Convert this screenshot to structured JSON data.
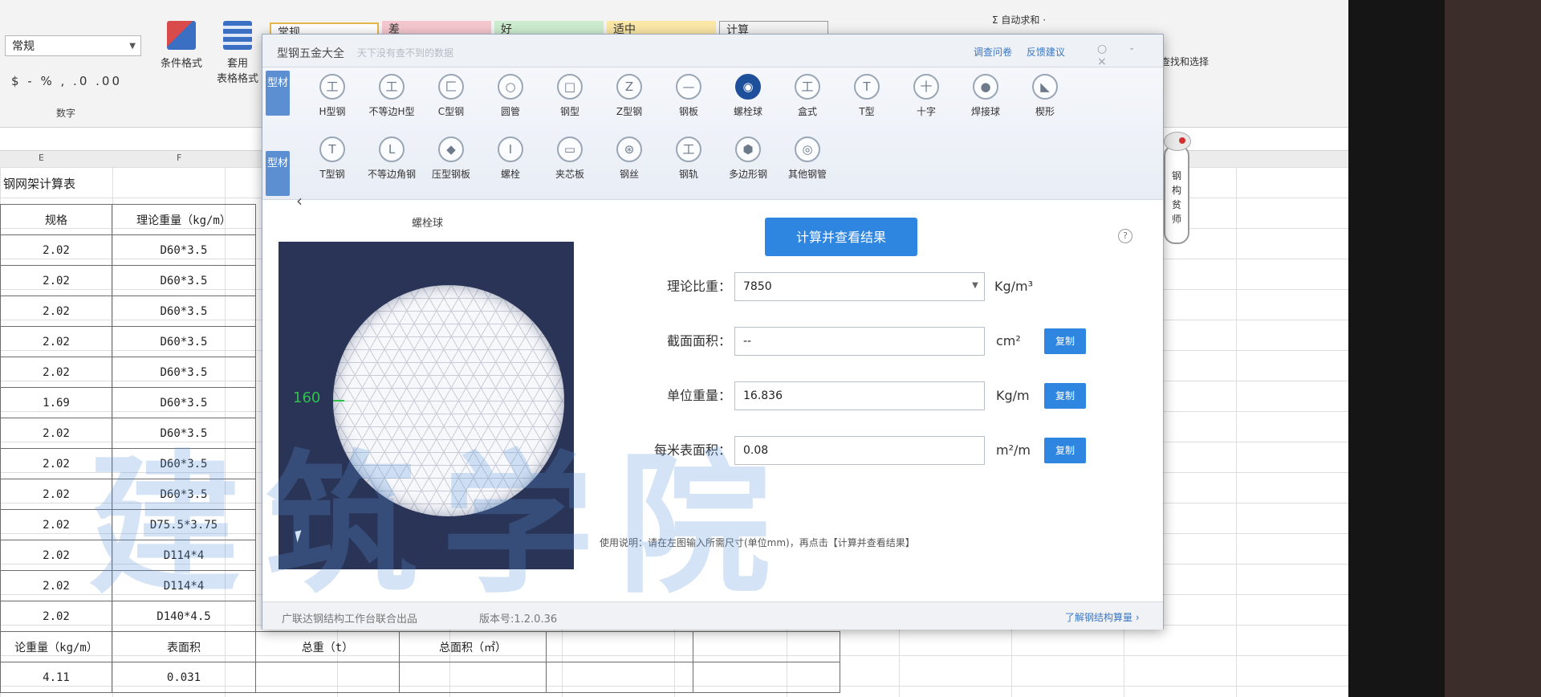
{
  "ribbon": {
    "format_select": "常规",
    "number_format_icons": "$ - % , .0 .00",
    "number_group_label": "数字",
    "cond_format_label": "条件格式",
    "table_format_label_1": "套用",
    "table_format_label_2": "表格格式",
    "styles": [
      {
        "label": "常规",
        "bg": "#ffffff"
      },
      {
        "label": "差",
        "bg": "#f4c7ce"
      },
      {
        "label": "好",
        "bg": "#cdeccf"
      },
      {
        "label": "适中",
        "bg": "#fbe7a6"
      },
      {
        "label": "计算",
        "bg": "#f2f2f2"
      }
    ],
    "autosum_label": "Σ 自动求和 ·",
    "find_select_label": "查找和选择"
  },
  "sheet": {
    "col_letters": [
      "E",
      "F"
    ],
    "title": "钢网架计算表",
    "headers": [
      "规格",
      "理论重量（kg/m）"
    ],
    "rows": [
      [
        "2.02",
        "D60*3.5"
      ],
      [
        "2.02",
        "D60*3.5"
      ],
      [
        "2.02",
        "D60*3.5"
      ],
      [
        "2.02",
        "D60*3.5"
      ],
      [
        "2.02",
        "D60*3.5"
      ],
      [
        "1.69",
        "D60*3.5"
      ],
      [
        "2.02",
        "D60*3.5"
      ],
      [
        "2.02",
        "D60*3.5"
      ],
      [
        "2.02",
        "D60*3.5"
      ],
      [
        "2.02",
        "D75.5*3.75"
      ],
      [
        "2.02",
        "D114*4"
      ],
      [
        "2.02",
        "D114*4"
      ],
      [
        "2.02",
        "D140*4.5"
      ]
    ],
    "summary_headers": [
      "论重量（kg/m）",
      "表面积",
      "总重（t）",
      "总面积（㎡）"
    ],
    "summary_values": [
      "4.11",
      "0.031"
    ],
    "side_pill_text": "钢构贫师"
  },
  "dialog": {
    "app_title": "型钢五金大全",
    "app_subtitle": "天下没有查不到的数据",
    "links": [
      "调查问卷",
      "反馈建议"
    ],
    "window_buttons": "○ - ×",
    "tabs": [
      "型材",
      "型材"
    ],
    "row1_items": [
      {
        "label": "H型钢",
        "icon": "工"
      },
      {
        "label": "不等边H型",
        "icon": "工"
      },
      {
        "label": "C型钢",
        "icon": "匚"
      },
      {
        "label": "圆管",
        "icon": "○"
      },
      {
        "label": "钢型",
        "icon": "□"
      },
      {
        "label": "Z型钢",
        "icon": "Z"
      },
      {
        "label": "钢板",
        "icon": "—"
      },
      {
        "label": "螺栓球",
        "icon": "◉"
      },
      {
        "label": "盒式",
        "icon": "工"
      },
      {
        "label": "T型",
        "icon": "T"
      },
      {
        "label": "十字",
        "icon": "十"
      },
      {
        "label": "焊接球",
        "icon": "●"
      },
      {
        "label": "楔形",
        "icon": "◣"
      }
    ],
    "row2_items": [
      {
        "label": "T型钢",
        "icon": "T"
      },
      {
        "label": "不等边角钢",
        "icon": "L"
      },
      {
        "label": "压型钢板",
        "icon": "◆"
      },
      {
        "label": "螺栓",
        "icon": "Ⅰ"
      },
      {
        "label": "夹芯板",
        "icon": "▭"
      },
      {
        "label": "钢丝",
        "icon": "⊛"
      },
      {
        "label": "钢轨",
        "icon": "工"
      },
      {
        "label": "多边形钢",
        "icon": "⬢"
      },
      {
        "label": "其他钢管",
        "icon": "◎"
      }
    ],
    "selected_item": "螺栓球",
    "shape_title": "螺栓球",
    "dimension_value": "160",
    "calc_button": "计算并查看结果",
    "fields": {
      "density": {
        "label": "理论比重：",
        "value": "7850",
        "unit": "Kg/m³"
      },
      "section_area": {
        "label": "截面面积：",
        "value": "--",
        "unit": "cm²",
        "copy": "复制"
      },
      "unit_weight": {
        "label": "单位重量：",
        "value": "16.836",
        "unit": "Kg/m",
        "copy": "复制"
      },
      "surface_area": {
        "label": "每米表面积：",
        "value": "0.08",
        "unit": "m²/m",
        "copy": "复制"
      }
    },
    "usage_hint": "使用说明：请在左图输入所需尺寸(单位mm)，再点击【计算并查看结果】",
    "footer_credit": "广联达钢结构工作台联合出品",
    "footer_version": "版本号:1.2.0.36",
    "footer_link": "了解钢结构算量 ›"
  },
  "watermark": "建筑学院",
  "colors": {
    "accent": "#2f86e0",
    "canvas": "#2a3457",
    "tab": "#5b8fd2"
  }
}
